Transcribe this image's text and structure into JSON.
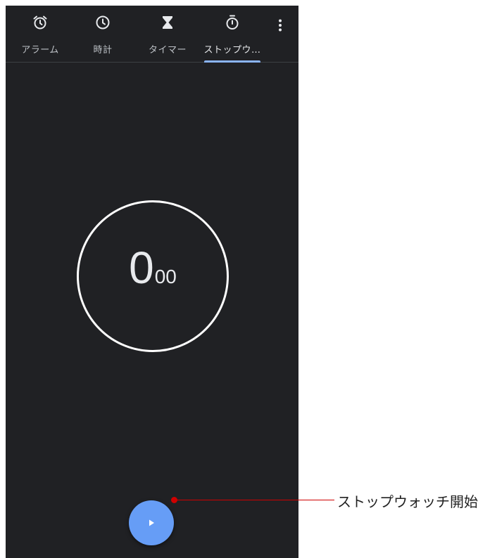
{
  "tabs": [
    {
      "label": "アラーム",
      "icon": "alarm-icon",
      "active": false
    },
    {
      "label": "時計",
      "icon": "clock-icon",
      "active": false
    },
    {
      "label": "タイマー",
      "icon": "hourglass-icon",
      "active": false
    },
    {
      "label": "ストップウ…",
      "icon": "stopwatch-icon",
      "active": true
    }
  ],
  "menu": {
    "icon": "more-vert-icon"
  },
  "stopwatch": {
    "seconds": "0",
    "hundredths": "00"
  },
  "fab": {
    "icon": "play-icon",
    "color": "#669df6"
  },
  "callout": {
    "label": "ストップウォッチ開始",
    "color": "#d00000"
  },
  "colors": {
    "background": "#202124",
    "accent": "#8ab4f8",
    "text": "#e8eaed"
  }
}
